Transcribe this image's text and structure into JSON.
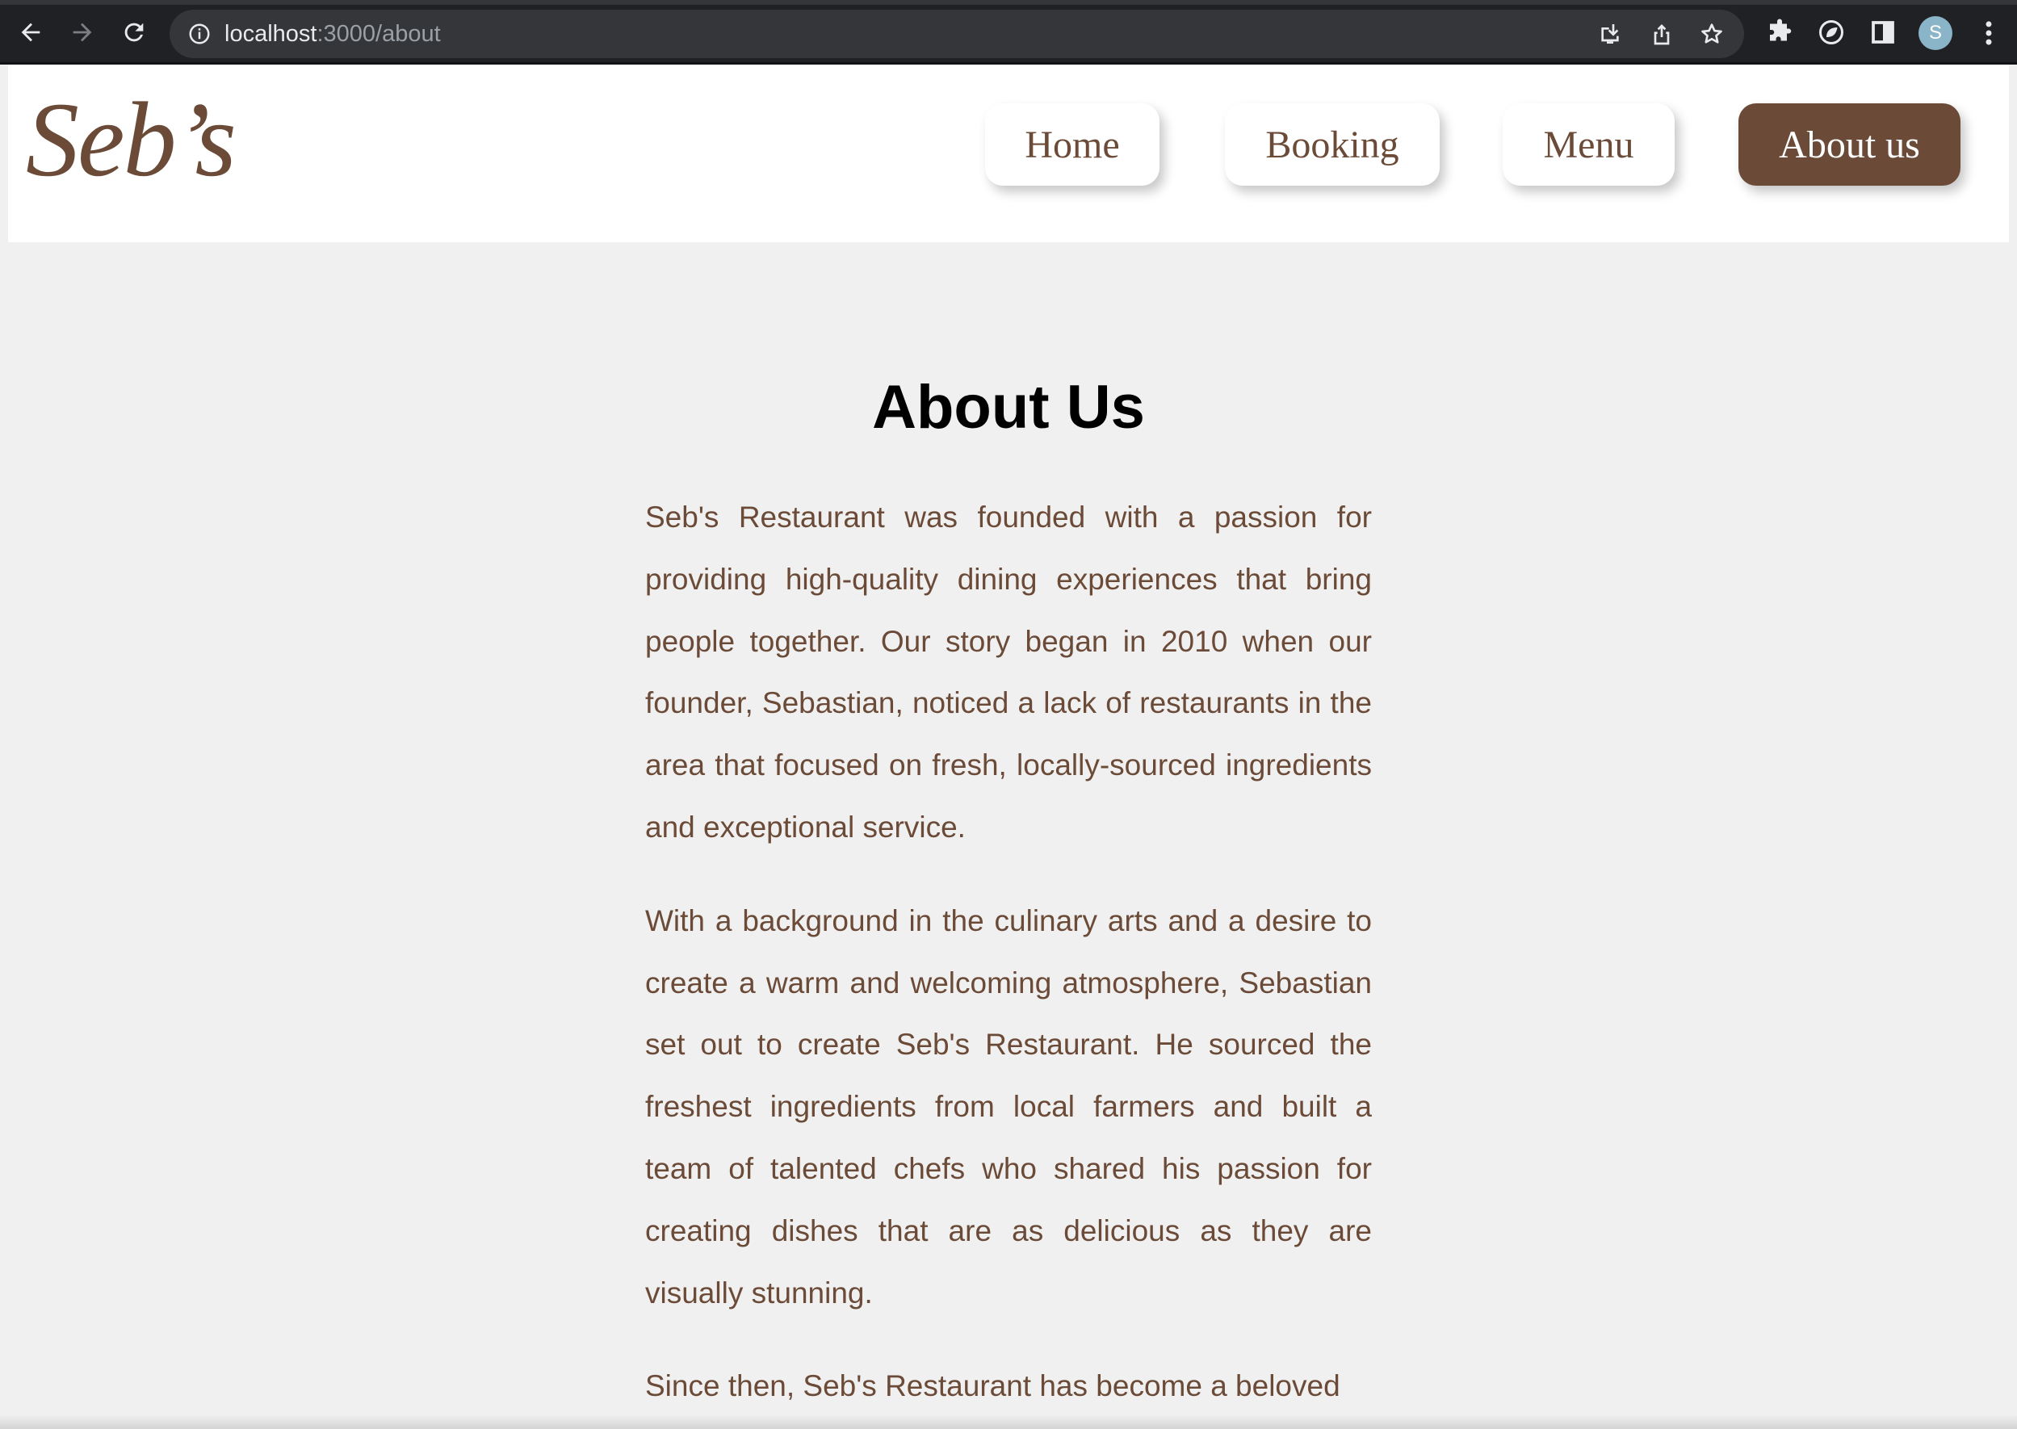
{
  "browser": {
    "url_host": "localhost",
    "url_path": ":3000/about",
    "profile_initial": "S"
  },
  "header": {
    "logo": "Seb’s",
    "nav": [
      {
        "label": "Home",
        "active": false
      },
      {
        "label": "Booking",
        "active": false
      },
      {
        "label": "Menu",
        "active": false
      },
      {
        "label": "About us",
        "active": true
      }
    ]
  },
  "main": {
    "title": "About Us",
    "paragraphs": [
      "Seb's Restaurant was founded with a passion for providing high-quality dining experiences that bring people together. Our story began in 2010 when our founder, Sebastian, noticed a lack of restaurants in the area that focused on fresh, locally-sourced ingredients and exceptional service.",
      "With a background in the culinary arts and a desire to create a warm and welcoming atmosphere, Sebastian set out to create Seb's Restaurant. He sourced the freshest ingredients from local farmers and built a team of talented chefs who shared his passion for creating dishes that are as delicious as they are visually stunning.",
      "Since then, Seb's Restaurant has become a beloved"
    ]
  },
  "colors": {
    "brand_brown": "#6b4b38",
    "page_background": "#f0f0f0",
    "header_background": "#ffffff",
    "browser_chrome": "#202124"
  },
  "icons": {
    "back": "back-arrow-icon",
    "forward": "forward-arrow-icon",
    "reload": "reload-icon",
    "site_info": "info-icon",
    "install": "install-app-icon",
    "share": "share-icon",
    "bookmark": "star-icon",
    "extensions": "puzzle-icon",
    "extension": "leaf-extension-icon",
    "side_panel": "side-panel-icon",
    "menu": "kebab-menu-icon"
  }
}
